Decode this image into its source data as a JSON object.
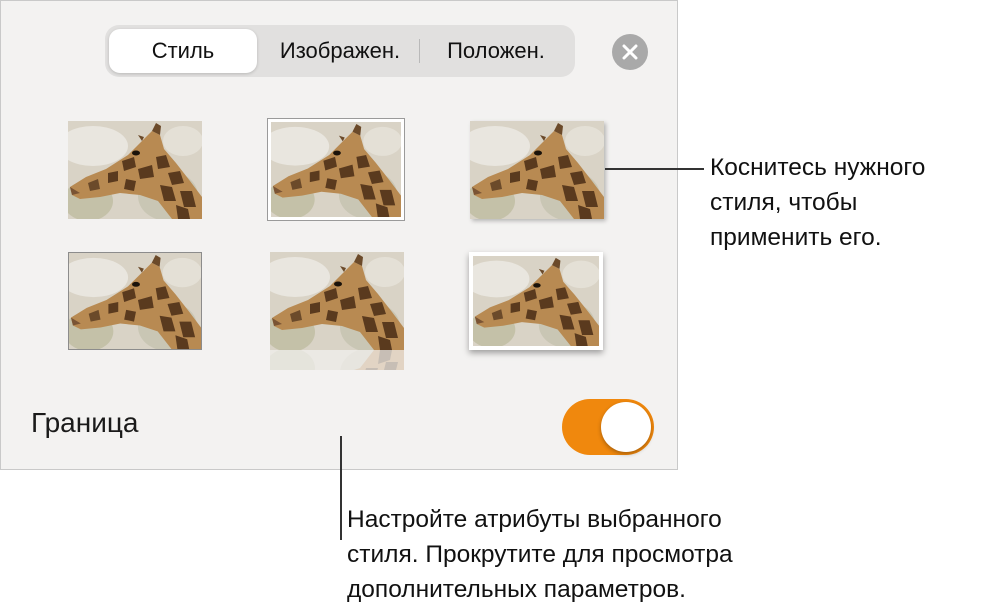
{
  "tabs": [
    {
      "label": "Стиль",
      "active": true
    },
    {
      "label": "Изображен.",
      "active": false
    },
    {
      "label": "Положен.",
      "active": false
    }
  ],
  "close_icon": "close-icon",
  "styles": [
    {
      "name": "no-border"
    },
    {
      "name": "thin-frame-selected"
    },
    {
      "name": "drop-shadow"
    },
    {
      "name": "thin-border"
    },
    {
      "name": "reflection"
    },
    {
      "name": "photo-frame-curled-shadow"
    }
  ],
  "border": {
    "label": "Граница",
    "enabled": true
  },
  "colors": {
    "accent": "#f0880d",
    "panel_bg": "#f3f2f1",
    "segment_bg": "#e1e0df"
  },
  "callouts": {
    "styles_note": "Коснитесь нужного\nстиля, чтобы\nприменить его.",
    "attributes_note": "Настройте атрибуты выбранного\nстиля. Прокрутите для просмотра\nдополнительных параметров."
  }
}
